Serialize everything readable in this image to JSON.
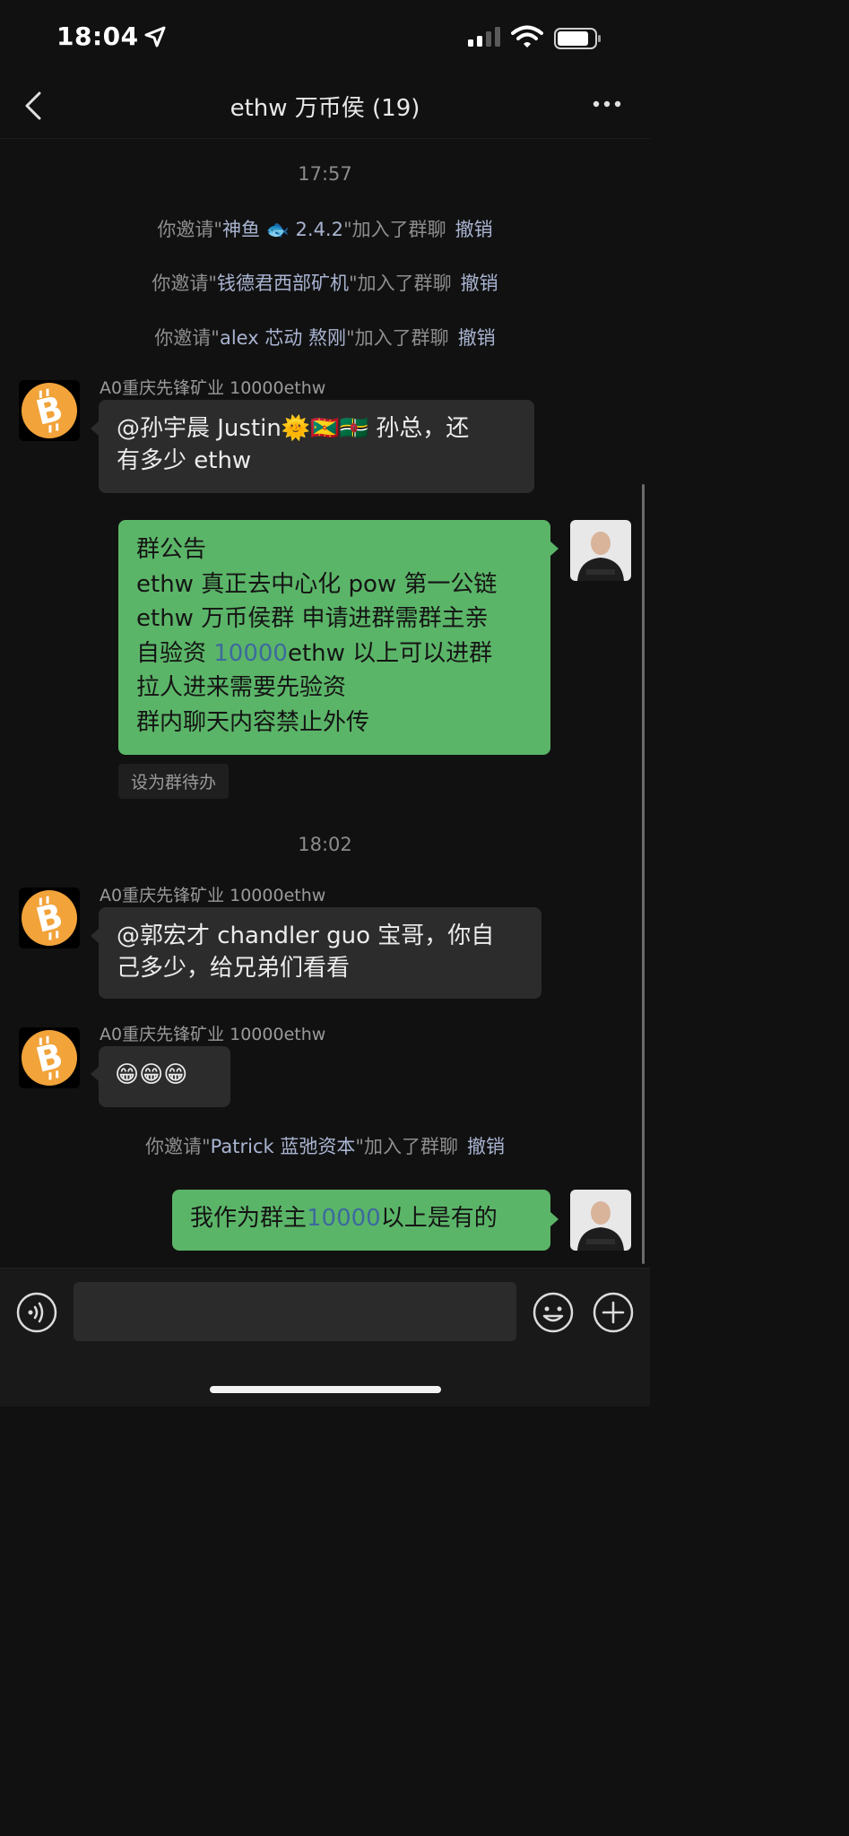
{
  "status_bar": {
    "time": "18:04"
  },
  "nav": {
    "title": "ethw 万币侯 (19)"
  },
  "chat": {
    "timestamp_1": "17:57",
    "invites_1": [
      {
        "prefix": "你邀请\"",
        "name": "神鱼 🐟 2.4.2",
        "suffix": "\"加入了群聊",
        "undo": "撤销"
      },
      {
        "prefix": "你邀请\"",
        "name": "钱德君西部矿机",
        "suffix": "\"加入了群聊",
        "undo": "撤销"
      },
      {
        "prefix": "你邀请\"",
        "name": "alex 芯动 熬刚",
        "suffix": "\"加入了群聊",
        "undo": "撤销"
      }
    ],
    "msg1": {
      "sender": "A0重庆先锋矿业 10000ethw",
      "line1": "@孙宇晨 Justin🌞🇬🇩🇩🇲 孙总，还",
      "line2": "有多少 ethw"
    },
    "msg2": {
      "lines": [
        "群公告",
        "ethw 真正去中心化 pow 第一公链",
        "ethw 万币侯群 申请进群需群主亲",
        "拉人进来需要先验资",
        "群内聊天内容禁止外传"
      ],
      "line4_pre": "自验资 ",
      "line4_hl": "10000",
      "line4_post": "ethw 以上可以进群",
      "todo": "设为群待办"
    },
    "timestamp_2": "18:02",
    "msg3": {
      "sender": "A0重庆先锋矿业 10000ethw",
      "line1": "@郭宏才 chandler guo 宝哥，你自",
      "line2": "己多少，给兄弟们看看"
    },
    "msg4": {
      "sender": "A0重庆先锋矿业 10000ethw",
      "text": "😁😁😁"
    },
    "invite_2": {
      "prefix": "你邀请\"",
      "name": "Patrick 蓝弛资本",
      "suffix": "\"加入了群聊",
      "undo": "撤销"
    },
    "msg5": {
      "pre": "我作为群主",
      "hl": "10000",
      "post": "以上是有的"
    }
  },
  "colors": {
    "my_bubble": "#5bb568",
    "their_bubble": "#2c2c2c",
    "bitcoin": "#f2a33a",
    "link": "#a9b4d1"
  },
  "icons": [
    "location-arrow-icon",
    "signal-icon",
    "wifi-icon",
    "battery-icon",
    "back-chevron-icon",
    "more-dots-icon",
    "bitcoin-avatar",
    "voice-icon",
    "emoji-icon",
    "plus-icon"
  ]
}
